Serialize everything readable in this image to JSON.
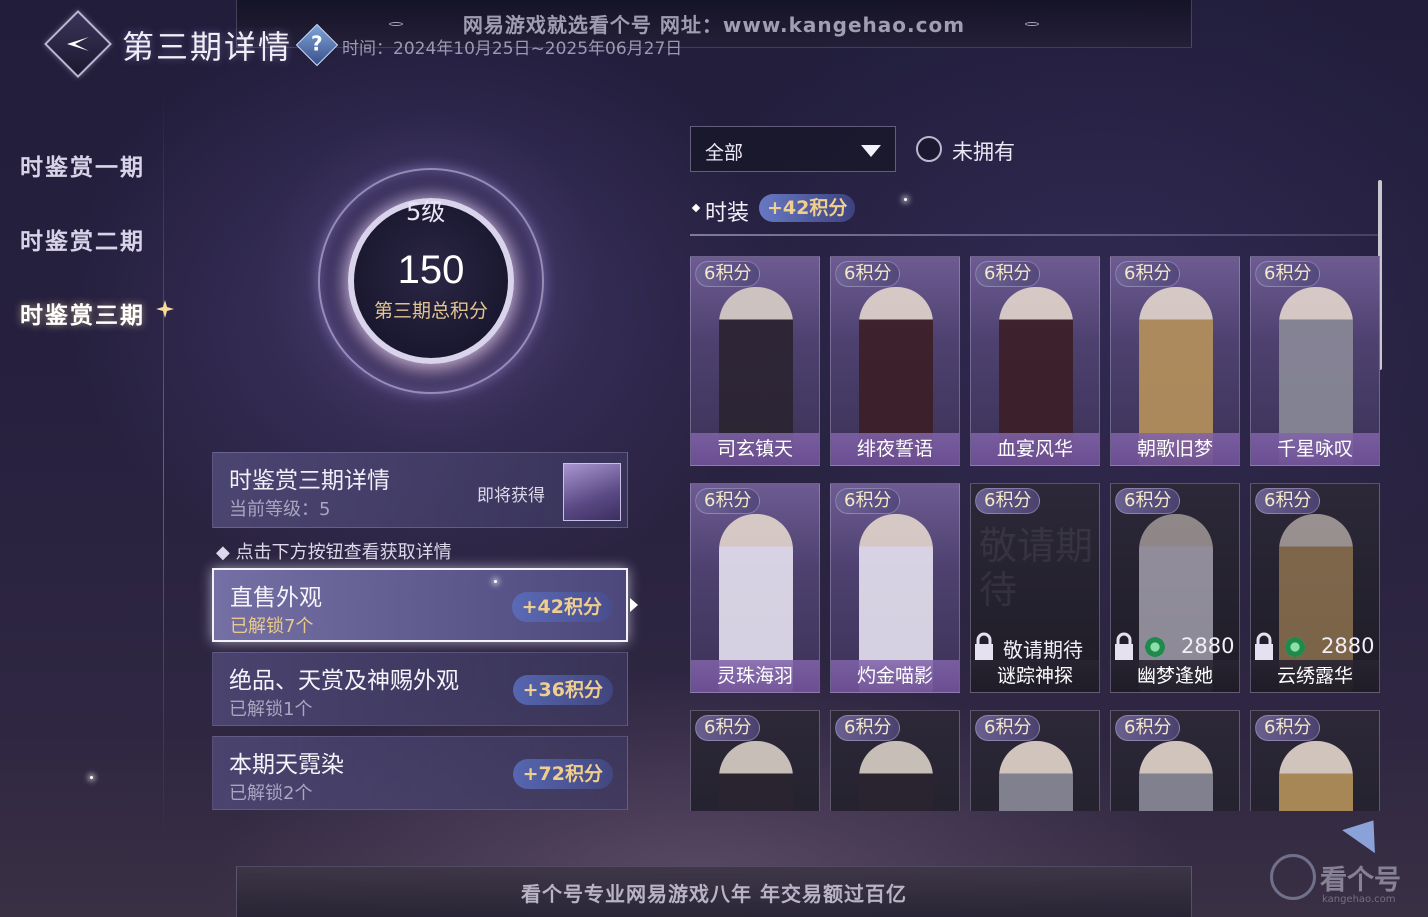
{
  "top_banner": {
    "text": "网易游戏就选看个号  网址：www.kangehao.com"
  },
  "header": {
    "title": "第三期详情",
    "help_label": "?",
    "time_range": "时间：2024年10月25日~2025年06月27日"
  },
  "nav": {
    "items": [
      {
        "label": "时鉴赏一期",
        "active": false
      },
      {
        "label": "时鉴赏二期",
        "active": false
      },
      {
        "label": "时鉴赏三期",
        "active": true
      }
    ]
  },
  "score": {
    "level": "5级",
    "total": "150",
    "label": "第三期总积分"
  },
  "detail": {
    "title": "时鉴赏三期详情",
    "current_level": "当前等级：5",
    "soon_label": "即将获得"
  },
  "hint": "点击下方按钮查看获取详情",
  "categories": [
    {
      "title": "直售外观",
      "sub": "已解锁7个",
      "points": "+42积分",
      "active": true
    },
    {
      "title": "绝品、天赏及神赐外观",
      "sub": "已解锁1个",
      "points": "+36积分",
      "active": false
    },
    {
      "title": "本期天霓染",
      "sub": "已解锁2个",
      "points": "+72积分",
      "active": false
    }
  ],
  "filters": {
    "select_value": "全部",
    "toggle_label": "未拥有"
  },
  "section": {
    "title": "时装",
    "points": "+42积分"
  },
  "cards": [
    {
      "badge": "6积分",
      "name": "司玄镇天",
      "owned": true
    },
    {
      "badge": "6积分",
      "name": "绯夜誓语",
      "owned": true
    },
    {
      "badge": "6积分",
      "name": "血宴风华",
      "owned": true
    },
    {
      "badge": "6积分",
      "name": "朝歌旧梦",
      "owned": true
    },
    {
      "badge": "6积分",
      "name": "千星咏叹",
      "owned": true
    },
    {
      "badge": "6积分",
      "name": "灵珠海羽",
      "owned": true
    },
    {
      "badge": "6积分",
      "name": "灼金喵影",
      "owned": true
    },
    {
      "badge": "6积分",
      "name": "谜踪神探",
      "owned": false,
      "status": "敬请期待",
      "watermark": "敬请期待"
    },
    {
      "badge": "6积分",
      "name": "幽梦逢她",
      "owned": false,
      "price": "2880"
    },
    {
      "badge": "6积分",
      "name": "云绣露华",
      "owned": false,
      "price": "2880"
    },
    {
      "badge": "6积分",
      "name": "",
      "owned": true
    },
    {
      "badge": "6积分",
      "name": "",
      "owned": true
    },
    {
      "badge": "6积分",
      "name": "",
      "owned": true
    },
    {
      "badge": "6积分",
      "name": "",
      "owned": true
    },
    {
      "badge": "6积分",
      "name": "",
      "owned": true
    }
  ],
  "bottom_banner": {
    "text": "看个号专业网易游戏八年  年交易额过百亿"
  },
  "logo": {
    "name": "看个号",
    "sub": "kangehao.com"
  },
  "icons": {
    "back": "back-arrow-icon",
    "help": "question-icon",
    "dropdown": "chevron-down-icon",
    "lock": "lock-icon",
    "currency": "jade-coin-icon",
    "next": "next-arrow-icon"
  },
  "colors": {
    "gold_text": "#f0cf8e",
    "card_purple": "#6d5b92",
    "background": "#211d3b"
  }
}
